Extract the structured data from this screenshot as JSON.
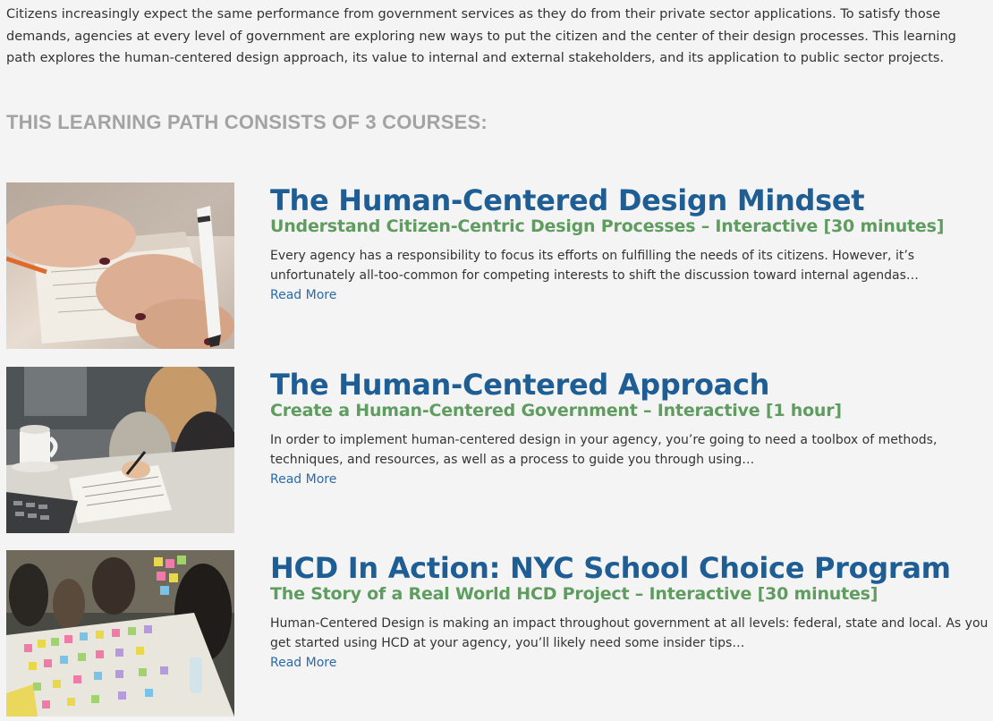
{
  "intro_text": "Citizens increasingly expect the same performance from government services as they do from their private sector applications. To satisfy those demands, agencies at every level of government are exploring new ways to put the citizen and the center of their design processes. This learning path explores the human-centered design approach, its value to internal and external stakeholders, and its application to public sector projects.",
  "section_heading": "THIS LEARNING PATH CONSISTS OF 3 COURSES:",
  "courses": [
    {
      "title": "The Human-Centered Design Mindset",
      "subtitle": "Understand Citizen-Centric Design Processes – Interactive [30 minutes]",
      "description": "Every agency has a responsibility to focus its efforts on fulfilling the needs of its citizens. However, it’s unfortunately all-too-common for competing interests to shift the discussion toward internal agendas…",
      "read_more": "Read More",
      "image_alt": "hands-writing-notes-photo"
    },
    {
      "title": "The Human-Centered Approach",
      "subtitle": "Create a Human-Centered Government – Interactive [1 hour]",
      "description": "In order to implement human-centered design in your agency, you’re going to need a toolbox of methods, techniques, and resources, as well as a process to guide you through using…",
      "read_more": "Read More",
      "image_alt": "team-working-at-table-photo"
    },
    {
      "title": "HCD In Action: NYC School Choice Program",
      "subtitle": "The Story of a Real World HCD Project – Interactive [30 minutes]",
      "description": "Human-Centered Design is making an impact throughout government at all levels: federal, state and local. As you get started using HCD at your agency, you’ll likely need some insider tips…",
      "read_more": "Read More",
      "image_alt": "sticky-notes-workshop-photo"
    }
  ],
  "colors": {
    "title": "#1f5e94",
    "subtitle": "#5f9c5f",
    "heading": "#a3a3a3",
    "link": "#2b6aa8",
    "body_text": "#333333",
    "background": "#f4f4f4"
  }
}
